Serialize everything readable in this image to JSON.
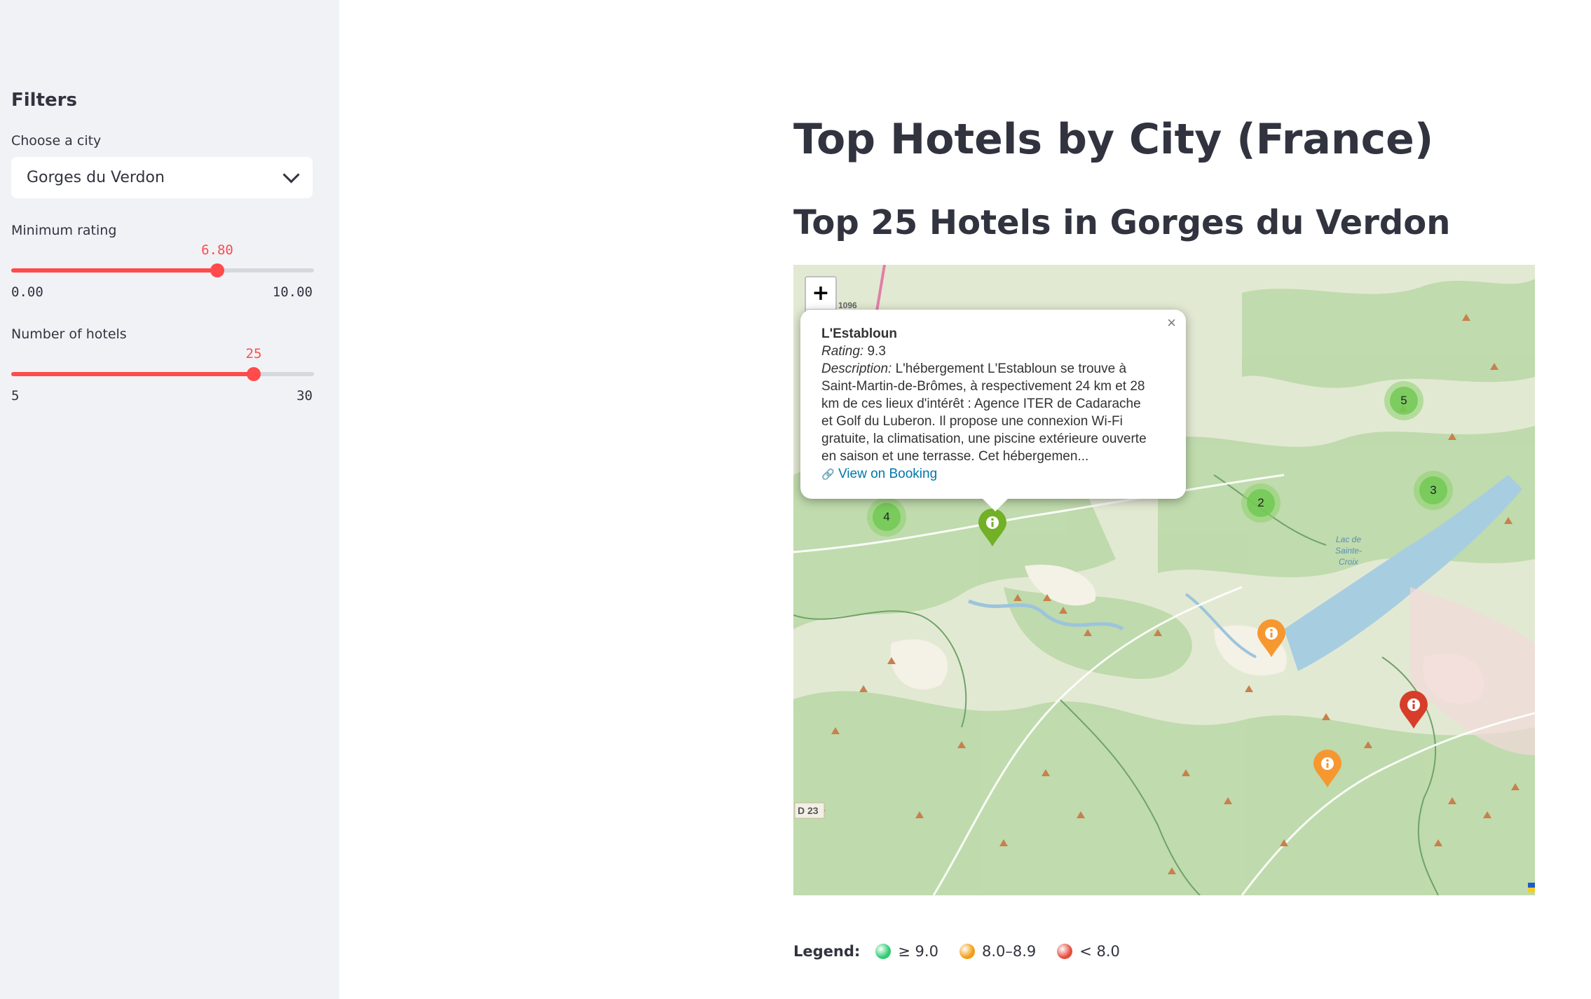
{
  "sidebar": {
    "title": "Filters",
    "city_label": "Choose a city",
    "city_value": "Gorges du Verdon",
    "rating": {
      "label": "Minimum rating",
      "value": "6.80",
      "min": "0.00",
      "max": "10.00",
      "fraction": 0.68
    },
    "hotels": {
      "label": "Number of hotels",
      "value": "25",
      "min": "5",
      "max": "30",
      "fraction": 0.8
    }
  },
  "main": {
    "title": "Top Hotels by City (France)",
    "subtitle": "Top 25 Hotels in Gorges du Verdon"
  },
  "map": {
    "zoom_in": "+",
    "zoom_out": "−",
    "road_label_1": "D 23",
    "road_label_2": "1096",
    "lake_label_1": "Lac de",
    "lake_label_2": "Sainte-",
    "lake_label_3": "Croix",
    "popup": {
      "name": "L'Establoun",
      "rating_label": "Rating:",
      "rating_value": "9.3",
      "description_label": "Description:",
      "description_lines": [
        "L'hébergement L'Establoun se trouve à",
        "Saint-Martin-de-Brômes, à respectivement 24 km et 28",
        "km de ces lieux d'intérêt : Agence ITER de Cadarache",
        "et Golf du Luberon. Il propose une connexion Wi-Fi",
        "gratuite, la climatisation, une piscine extérieure ouverte",
        "en saison et une terrasse. Cet hébergemen..."
      ],
      "link_icon": "🔗",
      "link_text": "View on Booking",
      "close": "×"
    },
    "clusters": [
      "5",
      "2",
      "3",
      "4"
    ],
    "marker_colors": {
      "green": "#72b026",
      "orange": "#f69730",
      "red": "#d63e2a"
    }
  },
  "legend": {
    "title": "Legend:",
    "items": [
      {
        "label": "≥ 9.0",
        "color": "#2ecc71"
      },
      {
        "label": "8.0–8.9",
        "color": "#f39c12"
      },
      {
        "label": "< 8.0",
        "color": "#e74c3c"
      }
    ]
  }
}
